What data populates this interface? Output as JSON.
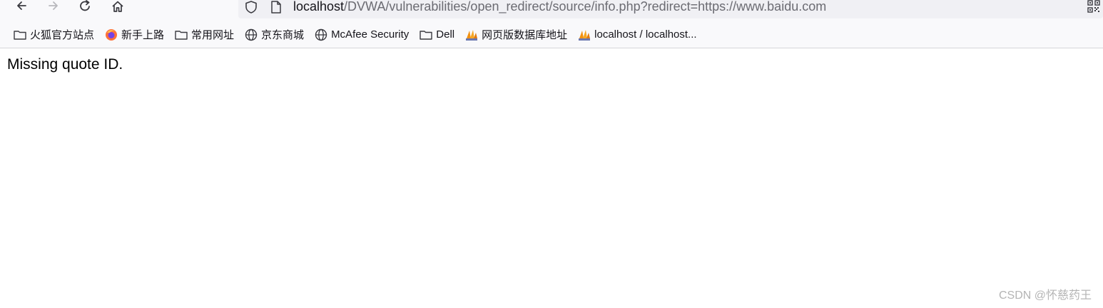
{
  "toolbar": {
    "back_icon": "arrow-left-icon",
    "forward_icon": "arrow-right-icon",
    "reload_icon": "reload-icon",
    "home_icon": "home-icon"
  },
  "urlbar": {
    "host": "localhost",
    "path": "/DVWA/vulnerabilities/open_redirect/source/info.php?redirect=https://www.baidu.com"
  },
  "bookmarks": [
    {
      "label": "火狐官方站点",
      "icon": "folder-icon"
    },
    {
      "label": "新手上路",
      "icon": "firefox-icon"
    },
    {
      "label": "常用网址",
      "icon": "folder-icon"
    },
    {
      "label": "京东商城",
      "icon": "globe-icon"
    },
    {
      "label": "McAfee Security",
      "icon": "globe-icon"
    },
    {
      "label": "Dell",
      "icon": "folder-icon"
    },
    {
      "label": "网页版数据库地址",
      "icon": "phpmyadmin-icon"
    },
    {
      "label": "localhost / localhost...",
      "icon": "phpmyadmin-icon"
    }
  ],
  "page": {
    "message": "Missing quote ID."
  },
  "watermark": "CSDN @怀慈药王"
}
